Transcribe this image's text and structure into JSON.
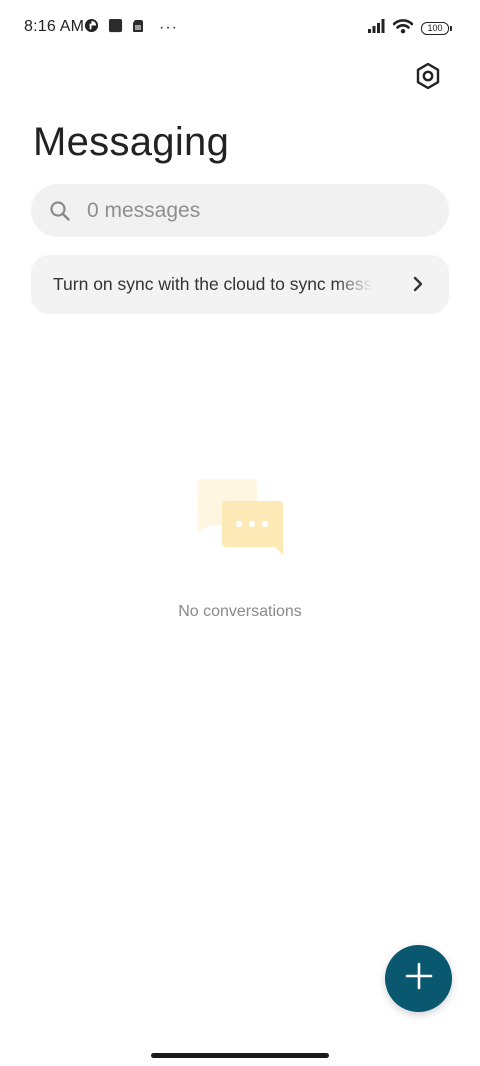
{
  "status_bar": {
    "time": "8:16 AM",
    "battery": "100",
    "more_dots": "···"
  },
  "header": {
    "title": "Messaging",
    "settings_icon": "settings-hexagon-icon"
  },
  "search": {
    "placeholder": "0 messages"
  },
  "sync_banner": {
    "text": "Turn on sync with the cloud to sync messages"
  },
  "empty_state": {
    "text": "No conversations"
  },
  "fab": {
    "icon": "plus-icon"
  },
  "colors": {
    "accent": "#0a5870",
    "bubble_back": "#fff6e1",
    "bubble_front": "#fde9b6"
  }
}
